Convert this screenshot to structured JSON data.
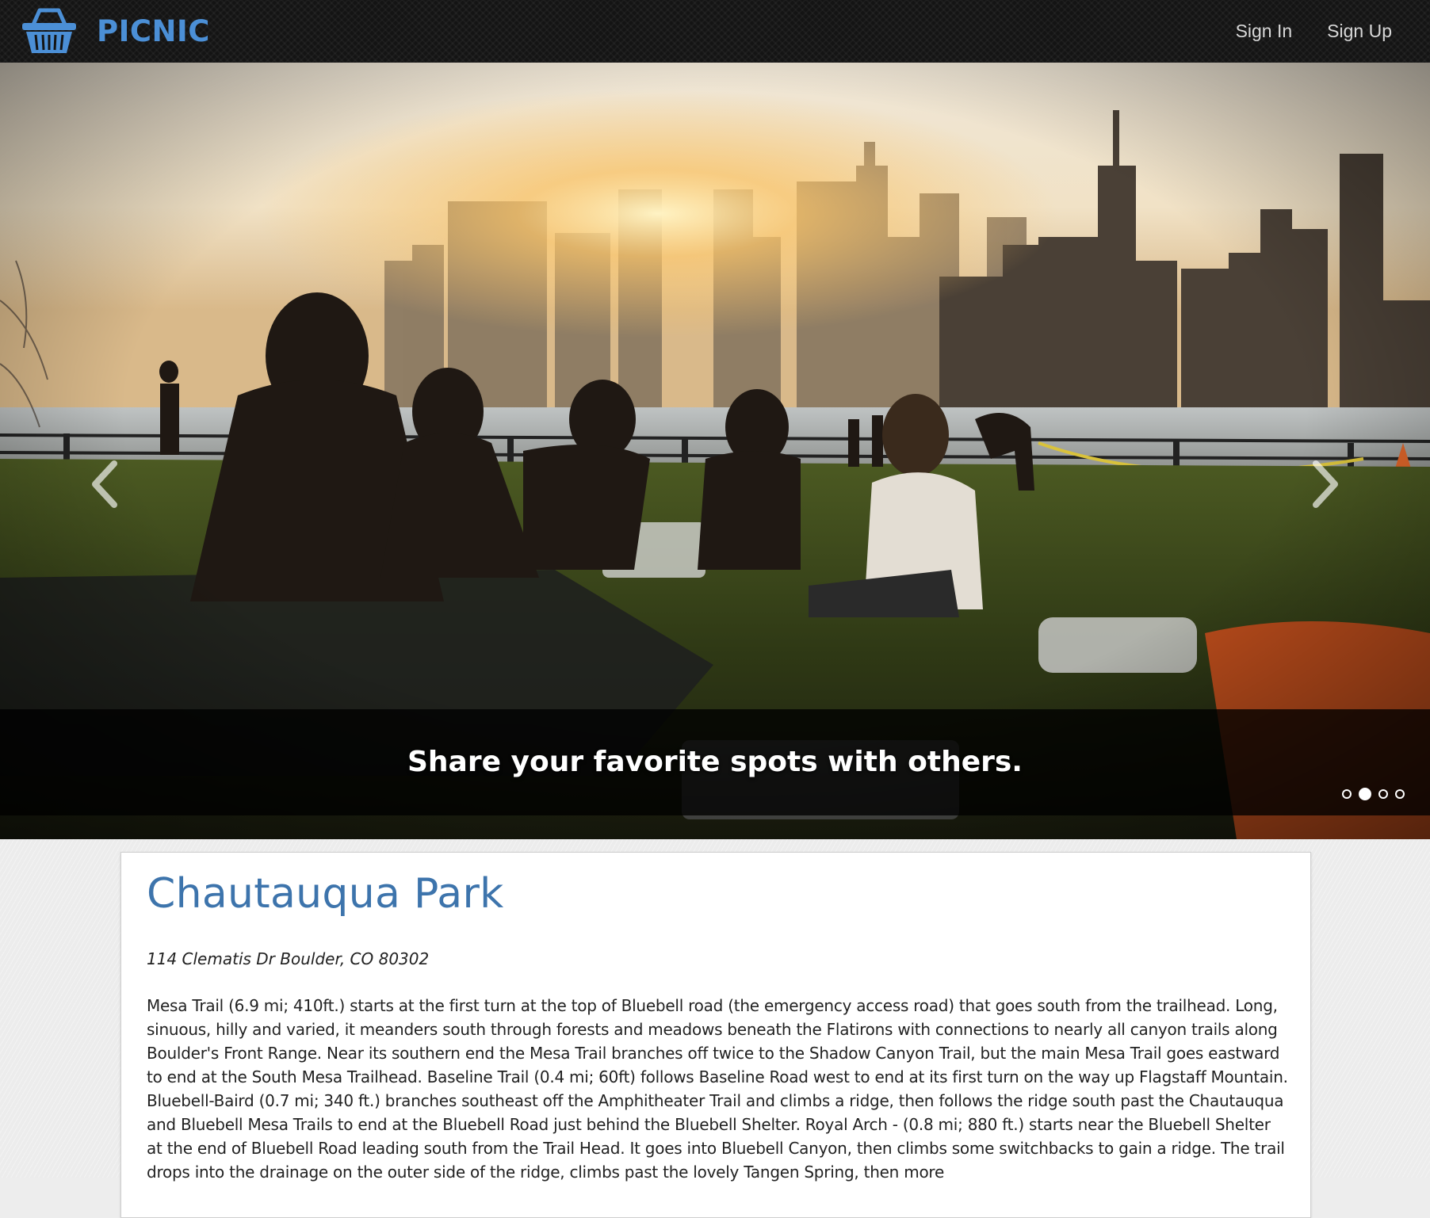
{
  "navbar": {
    "brand_name": "PICNIC",
    "brand_icon": "picnic-basket-icon",
    "brand_color": "#4b8fd6",
    "links": [
      {
        "label": "Sign In"
      },
      {
        "label": "Sign Up"
      }
    ]
  },
  "hero": {
    "caption": "Share your favorite spots with others.",
    "photo_description_icon": "picnic-skyline-photo",
    "prev_icon": "chevron-left-icon",
    "next_icon": "chevron-right-icon",
    "slide_count": 4,
    "active_slide": 2
  },
  "park": {
    "name": "Chautauqua Park",
    "address": "114 Clematis Dr Boulder, CO 80302",
    "description": "Mesa Trail (6.9 mi; 410ft.) starts at the first turn at the top of Bluebell road (the emergency access road) that goes south from the trailhead. Long, sinuous, hilly and varied, it meanders south through forests and meadows beneath the Flatirons with connections to nearly all canyon trails along Boulder's Front Range. Near its southern end the Mesa Trail branches off twice to the Shadow Canyon Trail, but the main Mesa Trail goes eastward to end at the South Mesa Trailhead. Baseline Trail (0.4 mi; 60ft) follows Baseline Road west to end at its first turn on the way up Flagstaff Mountain. Bluebell-Baird (0.7 mi; 340 ft.) branches southeast off the Amphitheater Trail and climbs a ridge, then follows the ridge south past the Chautauqua and Bluebell Mesa Trails to end at the Bluebell Road just behind the Bluebell Shelter. Royal Arch - (0.8 mi; 880 ft.) starts near the Bluebell Shelter at the end of Bluebell Road leading south from the Trail Head. It goes into Bluebell Canyon, then climbs some switchbacks to gain a ridge. The trail drops into the drainage on the outer side of the ridge, climbs past the lovely Tangen Spring, then more",
    "title_color": "#3d74ac"
  }
}
